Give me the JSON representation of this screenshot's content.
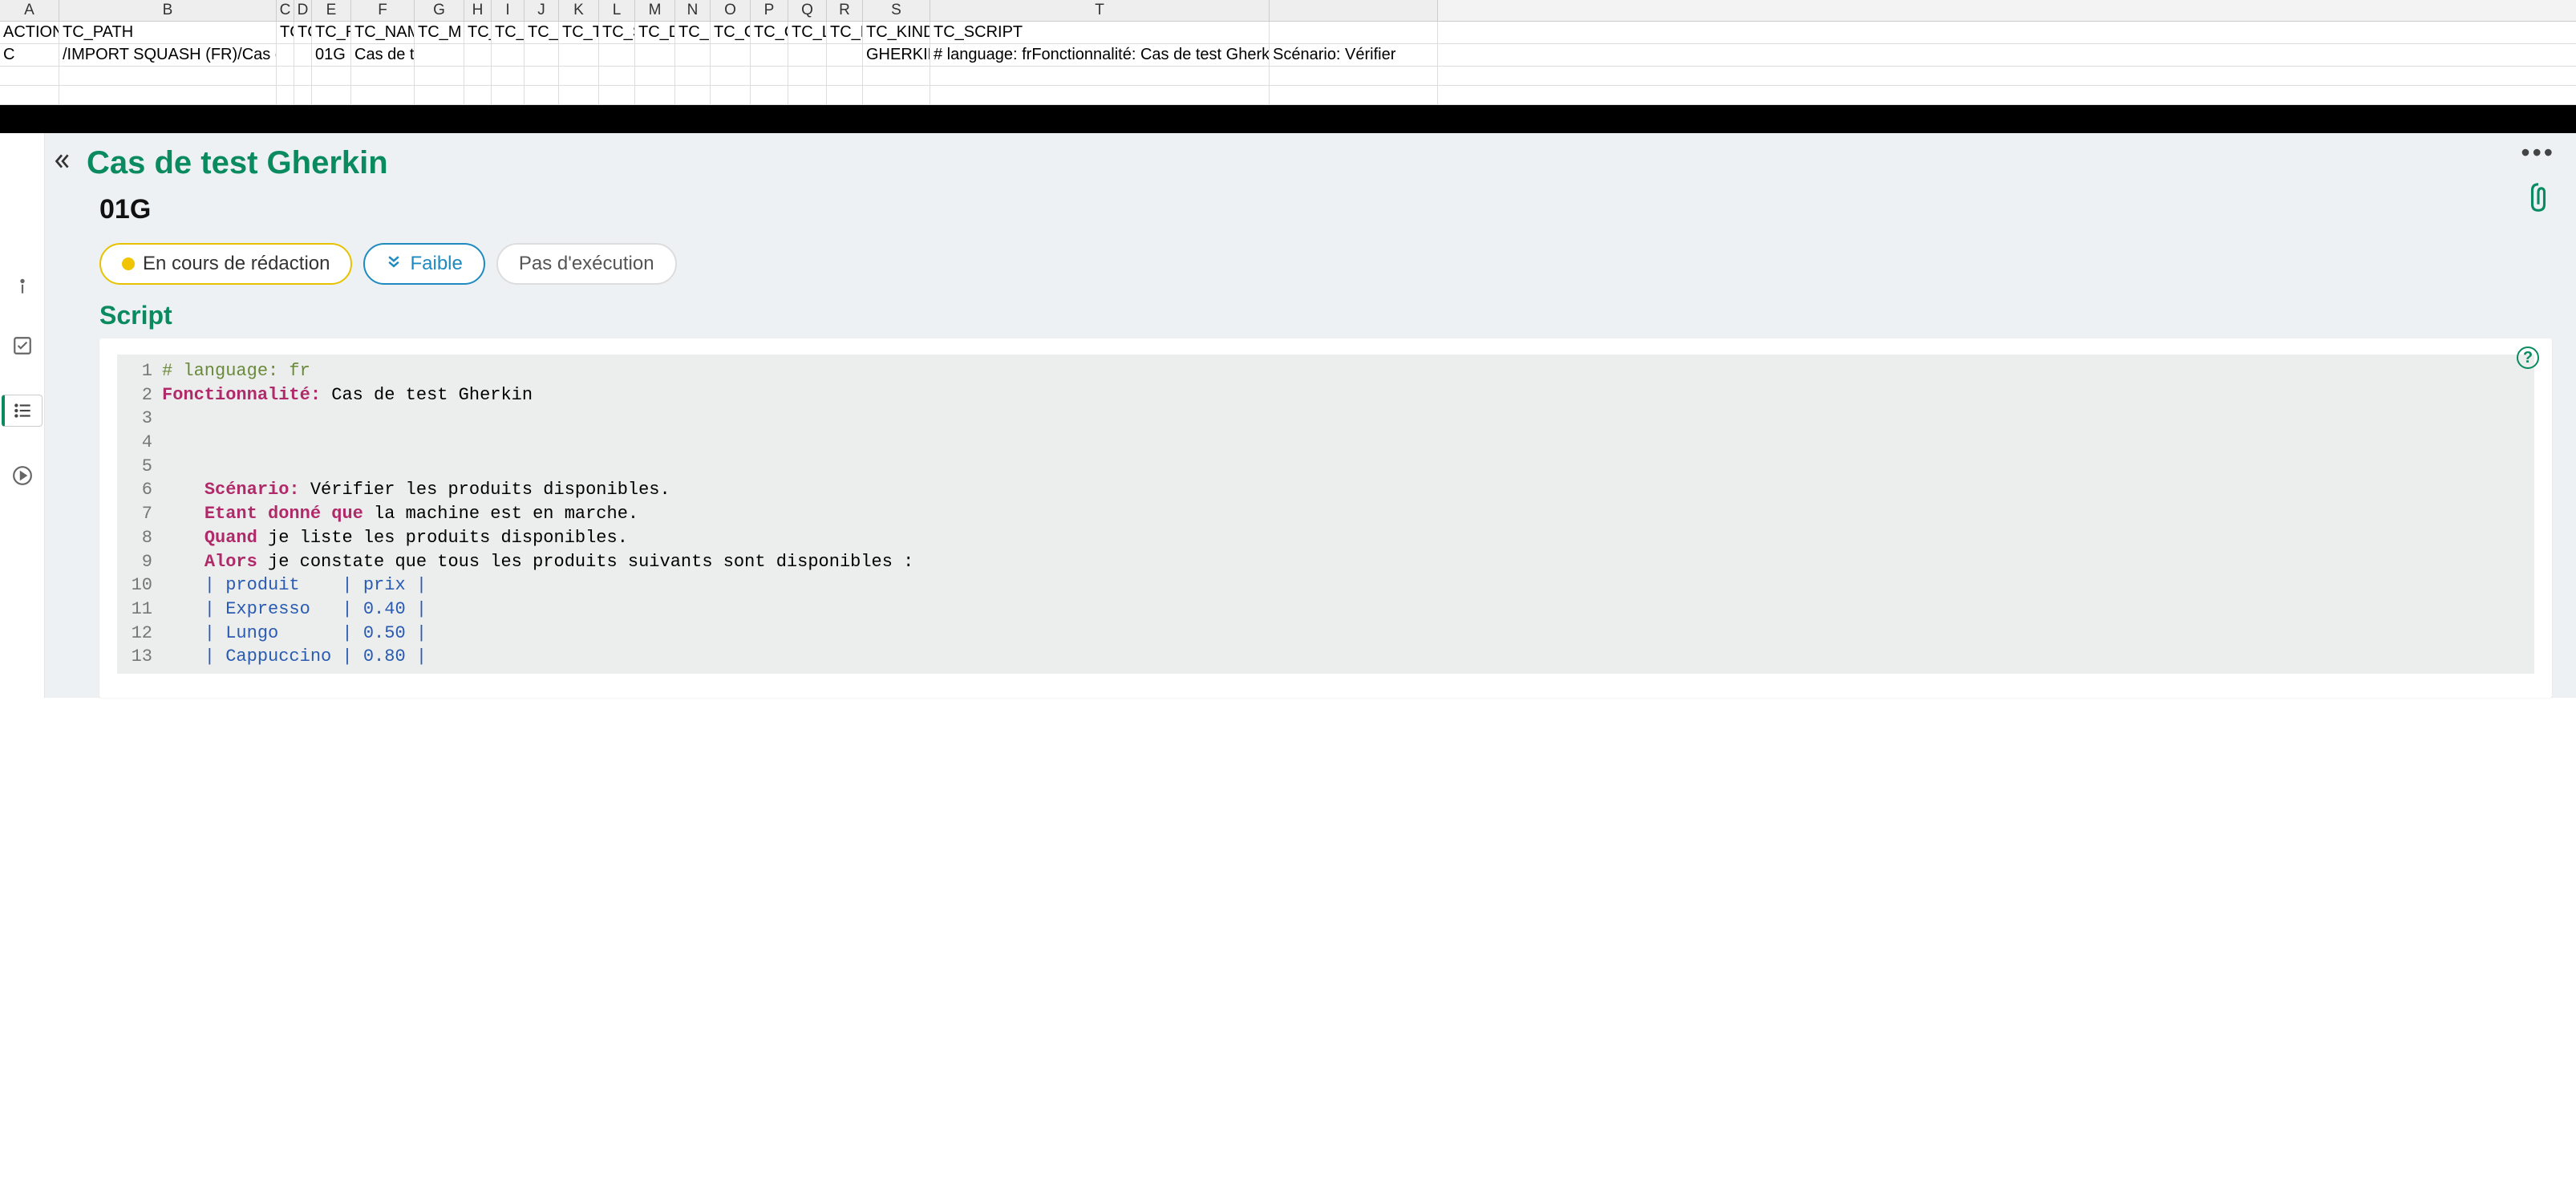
{
  "spreadsheet": {
    "col_letters": [
      "A",
      "B",
      "C",
      "D",
      "E",
      "F",
      "G",
      "H",
      "I",
      "J",
      "K",
      "L",
      "M",
      "N",
      "O",
      "P",
      "Q",
      "R",
      "S",
      "T",
      ""
    ],
    "headers": {
      "A": "ACTION",
      "B": "TC_PATH",
      "C": "TC_",
      "D": "TC_",
      "E": "TC_REF",
      "F": "TC_NAME",
      "G": "TC_M",
      "H": "TC_WE",
      "I": "TC_WE",
      "J": "TC_NA",
      "K": "TC_TYP",
      "L": "TC_ST",
      "M": "TC_DE",
      "N": "TC_PR",
      "O": "TC_CR",
      "P": "TC_CR",
      "Q": "TC_LAS",
      "R": "TC_LAS",
      "S": "TC_KIND",
      "T": "TC_SCRIPT",
      "U": ""
    },
    "row": {
      "A": "C",
      "B": "/IMPORT SQUASH (FR)/Cas de test Gherkin",
      "C": "",
      "D": "",
      "E": "01G",
      "F": "Cas de test Gherkin",
      "G": "",
      "H": "",
      "I": "",
      "J": "",
      "K": "",
      "L": "",
      "M": "",
      "N": "",
      "O": "",
      "P": "",
      "Q": "",
      "R": "",
      "S": "GHERKIN",
      "T": "# language: frFonctionnalité: Cas de test Gherkin",
      "U": "Scénario: Vérifier"
    }
  },
  "detail": {
    "title": "Cas de test Gherkin",
    "reference": "01G",
    "status_label": "En cours de rédaction",
    "priority_label": "Faible",
    "exec_label": "Pas d'exécution",
    "script_heading": "Script"
  },
  "script": {
    "lines": [
      {
        "n": "1"
      },
      {
        "n": "2"
      },
      {
        "n": "3"
      },
      {
        "n": "4"
      },
      {
        "n": "5"
      },
      {
        "n": "6"
      },
      {
        "n": "7"
      },
      {
        "n": "8"
      },
      {
        "n": "9"
      },
      {
        "n": "10"
      },
      {
        "n": "11"
      },
      {
        "n": "12"
      },
      {
        "n": "13"
      }
    ],
    "l1_comment": "# language: fr",
    "l2_kw": "Fonctionnalité:",
    "l2_txt": " Cas de test Gherkin",
    "l6_kw": "Scénario:",
    "l6_txt": " Vérifier les produits disponibles.",
    "l7_kw": "Etant donné que",
    "l7_txt": " la machine est en marche.",
    "l8_kw": "Quand",
    "l8_txt": " je liste les produits disponibles.",
    "l9_kw": "Alors",
    "l9_txt": " je constate que tous les produits suivants sont disponibles :",
    "l10": "    | produit    | prix |",
    "l11": "    | Expresso   | 0.40 |",
    "l12": "    | Lungo      | 0.50 |",
    "l13": "    | Cappuccino | 0.80 |"
  }
}
